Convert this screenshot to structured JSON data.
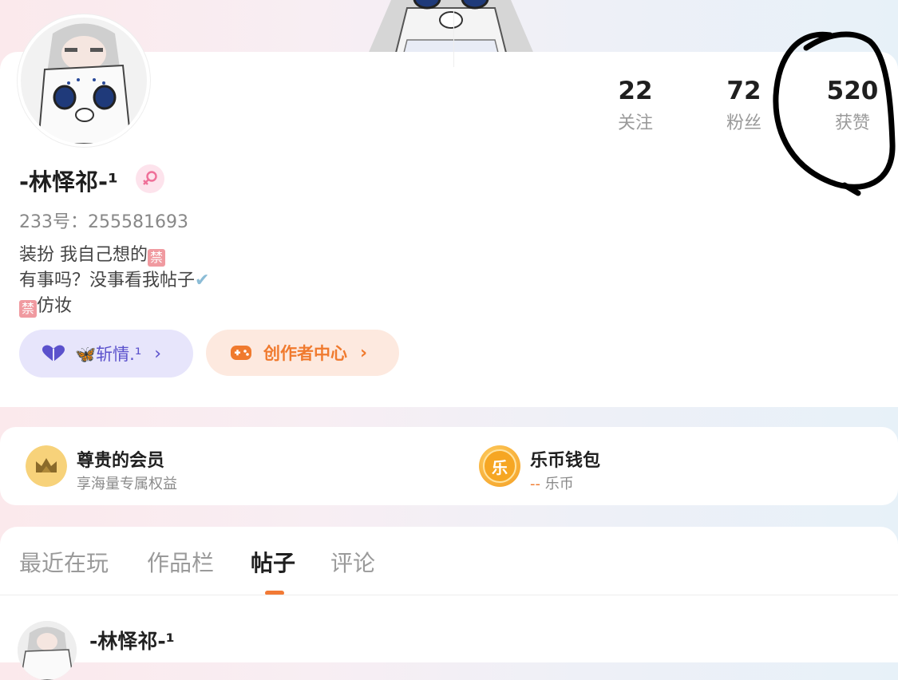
{
  "profile": {
    "username": "-林怿祁-¹",
    "gender_icon": "female-icon",
    "uid_label": "233号：",
    "uid_value": "255581693",
    "bio": {
      "line1_text": "装扮 我自己想的",
      "line2_text": "有事吗？没事看我帖子",
      "line3_text": "仿妆"
    },
    "ban_glyph": "禁",
    "check_glyph": "✔"
  },
  "stats": [
    {
      "value": "22",
      "label": "关注"
    },
    {
      "value": "72",
      "label": "粉丝"
    },
    {
      "value": "520",
      "label": "获赞"
    }
  ],
  "buttons": {
    "vip_label": "🦋斩情.¹",
    "creator_label": "创作者中心",
    "chevron": "›"
  },
  "services": {
    "membership": {
      "title": "尊贵的会员",
      "subtitle": "享海量专属权益",
      "icon": "crown-icon"
    },
    "wallet": {
      "title": "乐币钱包",
      "subtitle_prefix": "--",
      "subtitle": " 乐币",
      "icon": "coin-icon",
      "coin_char": "乐"
    }
  },
  "tabs": [
    {
      "label": "最近在玩"
    },
    {
      "label": "作品栏"
    },
    {
      "label": "帖子",
      "active": true
    },
    {
      "label": "评论"
    }
  ],
  "post": {
    "author": "-林怿祁-¹"
  },
  "colors": {
    "accent_orange": "#f27a35",
    "vip_purple": "#5b51cc",
    "annotation": "#000000"
  }
}
